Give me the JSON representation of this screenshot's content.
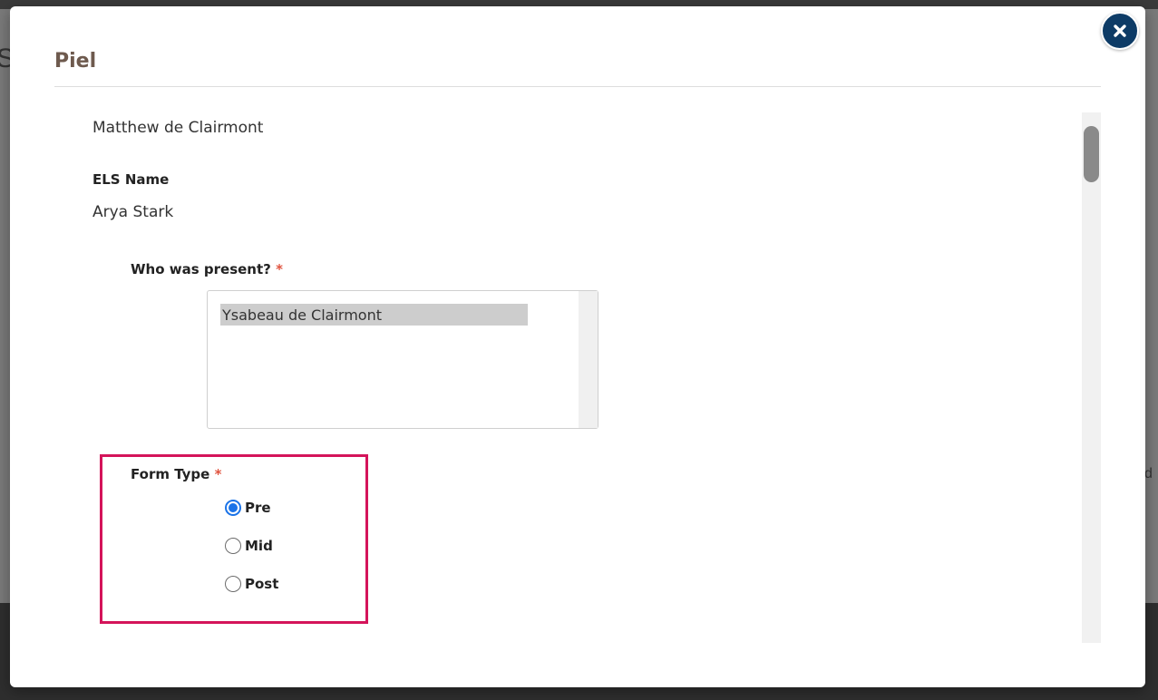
{
  "modal": {
    "title": "Piel"
  },
  "backdrop": {
    "left_fragment": "S",
    "right_fragment": "d"
  },
  "profile": {
    "user_name": "Matthew de Clairmont",
    "els_label": "ELS Name",
    "els_value": "Arya Stark"
  },
  "who_present": {
    "label": "Who was present?",
    "required_mark": "*",
    "options": [
      "Ysabeau de Clairmont"
    ]
  },
  "form_type": {
    "label": "Form Type",
    "required_mark": "*",
    "options": [
      {
        "label": "Pre",
        "checked": true
      },
      {
        "label": "Mid",
        "checked": false
      },
      {
        "label": "Post",
        "checked": false
      }
    ]
  },
  "colors": {
    "accent": "#1a73e8",
    "close_button": "#0d3b66",
    "highlight": "#d4145a",
    "required": "#e0533e",
    "title": "#6e5a4e"
  },
  "icons": {
    "close": "close-icon"
  }
}
